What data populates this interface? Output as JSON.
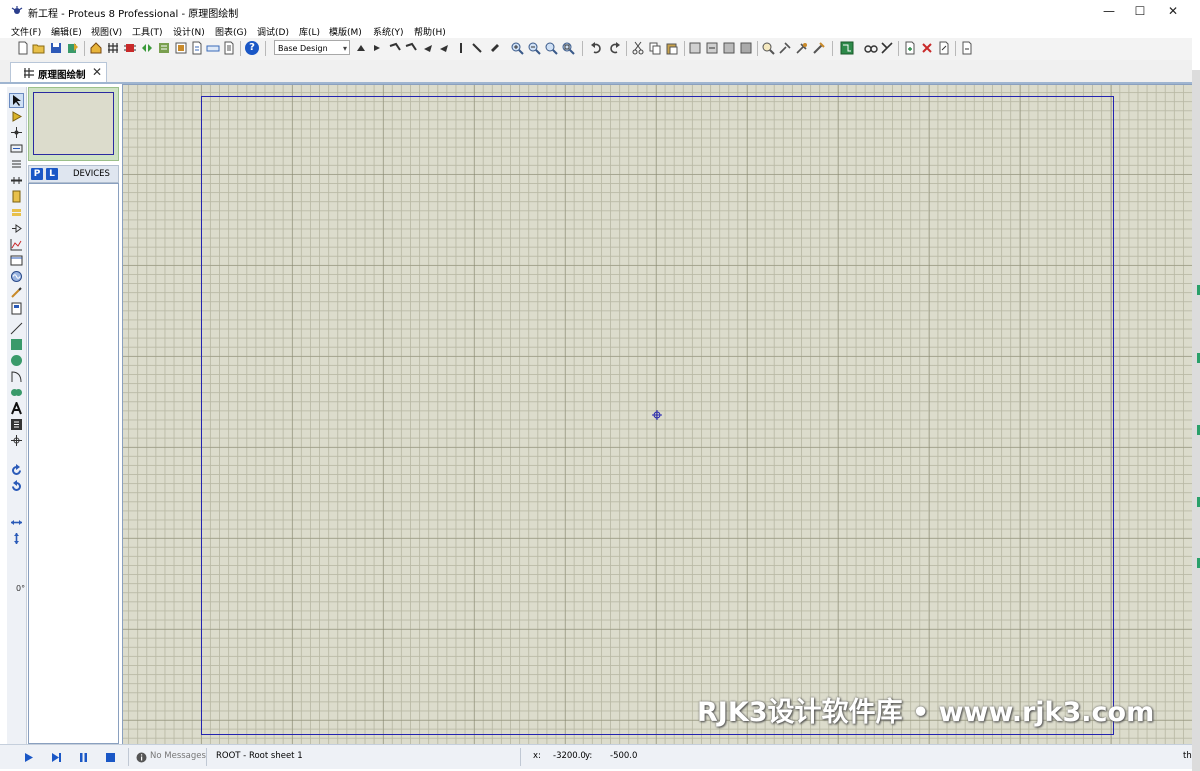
{
  "window": {
    "title": "新工程 - Proteus 8 Professional - 原理图绘制",
    "minimize": "—",
    "maximize": "☐",
    "close": "✕"
  },
  "menu": {
    "items": [
      "文件(F)",
      "编辑(E)",
      "视图(V)",
      "工具(T)",
      "设计(N)",
      "图表(G)",
      "调试(D)",
      "库(L)",
      "模版(M)",
      "系统(Y)",
      "帮助(H)"
    ]
  },
  "toolbar": {
    "design_select": "Base Design",
    "design_select_arrow": "▾",
    "help_glyph": "?"
  },
  "tab": {
    "label": "原理图绘制",
    "close": "✕"
  },
  "left_tools": {
    "rotation": "0°"
  },
  "devices": {
    "p_label": "P",
    "l_label": "L",
    "title": "DEVICES"
  },
  "watermark": "RJK3设计软件库 • www.rjk3.com",
  "status": {
    "messages": "No Messages",
    "sheet": "ROOT - Root sheet 1",
    "x_label": "x:",
    "x_value": "-3200.0",
    "y_label": "y:",
    "y_value": "-500.0",
    "units": "th"
  },
  "colors": {
    "canvas": "#dcdccc",
    "sheet_border": "#2424b0",
    "accent": "#1a57c6"
  }
}
